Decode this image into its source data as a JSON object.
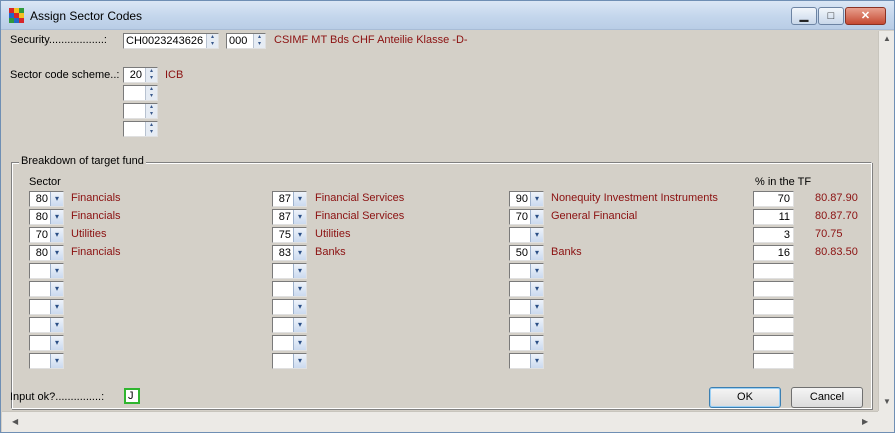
{
  "window": {
    "title": "Assign Sector Codes",
    "controls": {
      "minimize": "▁",
      "maximize": "□",
      "close": "✕"
    }
  },
  "security": {
    "label": "Security..................:",
    "isin": "CH0023243626",
    "suffix": "000",
    "name": "CSIMF MT Bds CHF Anteilie Klasse -D-"
  },
  "scheme": {
    "label": "Sector code scheme..:",
    "values": [
      "20",
      "",
      "",
      ""
    ],
    "name": "ICB"
  },
  "breakdown": {
    "title": "Breakdown of target fund",
    "sector_header": "Sector",
    "pct_header": "% in the TF",
    "rows": [
      {
        "c1": "80",
        "n1": "Financials",
        "c2": "87",
        "n2": "Financial Services",
        "c3": "90",
        "n3": "Nonequity Investment Instruments",
        "pct": "70",
        "code": "80.87.90"
      },
      {
        "c1": "80",
        "n1": "Financials",
        "c2": "87",
        "n2": "Financial Services",
        "c3": "70",
        "n3": "General Financial",
        "pct": "11",
        "code": "80.87.70"
      },
      {
        "c1": "70",
        "n1": "Utilities",
        "c2": "75",
        "n2": "Utilities",
        "c3": "",
        "n3": "",
        "pct": "3",
        "code": "70.75"
      },
      {
        "c1": "80",
        "n1": "Financials",
        "c2": "83",
        "n2": "Banks",
        "c3": "50",
        "n3": "Banks",
        "pct": "16",
        "code": "80.83.50"
      },
      {
        "c1": "",
        "n1": "",
        "c2": "",
        "n2": "",
        "c3": "",
        "n3": "",
        "pct": "",
        "code": ""
      },
      {
        "c1": "",
        "n1": "",
        "c2": "",
        "n2": "",
        "c3": "",
        "n3": "",
        "pct": "",
        "code": ""
      },
      {
        "c1": "",
        "n1": "",
        "c2": "",
        "n2": "",
        "c3": "",
        "n3": "",
        "pct": "",
        "code": ""
      },
      {
        "c1": "",
        "n1": "",
        "c2": "",
        "n2": "",
        "c3": "",
        "n3": "",
        "pct": "",
        "code": ""
      },
      {
        "c1": "",
        "n1": "",
        "c2": "",
        "n2": "",
        "c3": "",
        "n3": "",
        "pct": "",
        "code": ""
      },
      {
        "c1": "",
        "n1": "",
        "c2": "",
        "n2": "",
        "c3": "",
        "n3": "",
        "pct": "",
        "code": ""
      }
    ]
  },
  "footer": {
    "input_ok_label": "Input ok?...............:",
    "input_ok_value": "J",
    "ok_label": "OK",
    "cancel_label": "Cancel"
  },
  "icons": {
    "dropdown": "▾",
    "spin_up": "▴",
    "spin_down": "▾",
    "scroll_up": "▲",
    "scroll_down": "▼",
    "scroll_left": "◀",
    "scroll_right": "▶"
  },
  "colors": {
    "label_red": "#8b1010",
    "dialog_bg": "#d4d0c8",
    "input_ok_border": "#2fb52f"
  }
}
